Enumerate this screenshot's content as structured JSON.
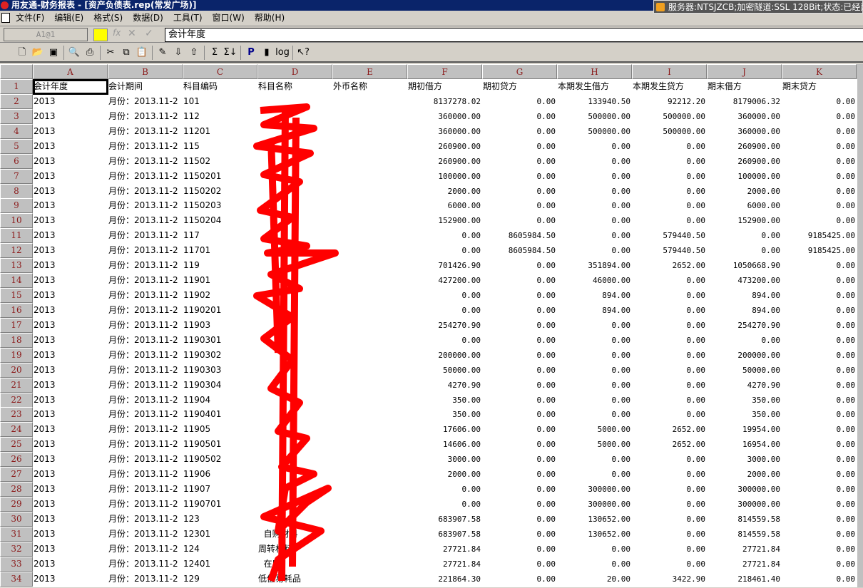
{
  "window": {
    "title": "用友通-财务报表 - [资产负债表.rep(常发广场)]",
    "server_status": "服务器:NTSJZCB;加密隧道:SSL 128Bit;状态:已经建"
  },
  "menu": [
    "文件(F)",
    "编辑(E)",
    "格式(S)",
    "数据(D)",
    "工具(T)",
    "窗口(W)",
    "帮助(H)"
  ],
  "formula": {
    "cell_ref": "A1@1",
    "fx": "fx",
    "cancel": "✕",
    "confirm": "✓",
    "value": "会计年度"
  },
  "toolbar": [
    "new-icon",
    "open-icon",
    "save-icon",
    "print-preview-icon",
    "print-icon",
    "cut-icon",
    "copy-icon",
    "paste-icon",
    "format-brush-icon",
    "sort-desc-icon",
    "sort-asc-icon",
    "sum-icon",
    "sum-column-icon",
    "p-icon",
    "marker-icon",
    "log-icon",
    "help-pointer-icon"
  ],
  "columns": [
    "A",
    "B",
    "C",
    "D",
    "E",
    "F",
    "G",
    "H",
    "I",
    "J",
    "K"
  ],
  "header_row": [
    "会计年度",
    "会计期间",
    "科目编码",
    "科目名称",
    "外币名称",
    "期初借方",
    "期初贷方",
    "本期发生借方",
    "本期发生贷方",
    "期末借方",
    "期末贷方"
  ],
  "year": "2013",
  "period": "月份：2013.11-2",
  "rows": [
    [
      "101",
      "",
      "8137278.02",
      "0.00",
      "133940.50",
      "92212.20",
      "8179006.32",
      "0.00"
    ],
    [
      "112",
      "",
      "360000.00",
      "0.00",
      "500000.00",
      "500000.00",
      "360000.00",
      "0.00"
    ],
    [
      "11201",
      "",
      "360000.00",
      "0.00",
      "500000.00",
      "500000.00",
      "360000.00",
      "0.00"
    ],
    [
      "115",
      "",
      "260900.00",
      "0.00",
      "0.00",
      "0.00",
      "260900.00",
      "0.00"
    ],
    [
      "11502",
      "",
      "260900.00",
      "0.00",
      "0.00",
      "0.00",
      "260900.00",
      "0.00"
    ],
    [
      "1150201",
      "",
      "100000.00",
      "0.00",
      "0.00",
      "0.00",
      "100000.00",
      "0.00"
    ],
    [
      "1150202",
      "",
      "2000.00",
      "0.00",
      "0.00",
      "0.00",
      "2000.00",
      "0.00"
    ],
    [
      "1150203",
      "",
      "6000.00",
      "0.00",
      "0.00",
      "0.00",
      "6000.00",
      "0.00"
    ],
    [
      "1150204",
      "",
      "152900.00",
      "0.00",
      "0.00",
      "0.00",
      "152900.00",
      "0.00"
    ],
    [
      "117",
      "",
      "0.00",
      "8605984.50",
      "0.00",
      "579440.50",
      "0.00",
      "9185425.00"
    ],
    [
      "11701",
      "",
      "0.00",
      "8605984.50",
      "0.00",
      "579440.50",
      "0.00",
      "9185425.00"
    ],
    [
      "119",
      "",
      "701426.90",
      "0.00",
      "351894.00",
      "2652.00",
      "1050668.90",
      "0.00"
    ],
    [
      "11901",
      "",
      "427200.00",
      "0.00",
      "46000.00",
      "0.00",
      "473200.00",
      "0.00"
    ],
    [
      "11902",
      "",
      "0.00",
      "0.00",
      "894.00",
      "0.00",
      "894.00",
      "0.00"
    ],
    [
      "1190201",
      "",
      "0.00",
      "0.00",
      "894.00",
      "0.00",
      "894.00",
      "0.00"
    ],
    [
      "11903",
      "",
      "254270.90",
      "0.00",
      "0.00",
      "0.00",
      "254270.90",
      "0.00"
    ],
    [
      "1190301",
      "",
      "0.00",
      "0.00",
      "0.00",
      "0.00",
      "0.00",
      "0.00"
    ],
    [
      "1190302",
      "",
      "200000.00",
      "0.00",
      "0.00",
      "0.00",
      "200000.00",
      "0.00"
    ],
    [
      "1190303",
      "",
      "50000.00",
      "0.00",
      "0.00",
      "0.00",
      "50000.00",
      "0.00"
    ],
    [
      "1190304",
      "",
      "4270.90",
      "0.00",
      "0.00",
      "0.00",
      "4270.90",
      "0.00"
    ],
    [
      "11904",
      "",
      "350.00",
      "0.00",
      "0.00",
      "0.00",
      "350.00",
      "0.00"
    ],
    [
      "1190401",
      "",
      "350.00",
      "0.00",
      "0.00",
      "0.00",
      "350.00",
      "0.00"
    ],
    [
      "11905",
      "",
      "17606.00",
      "0.00",
      "5000.00",
      "2652.00",
      "19954.00",
      "0.00"
    ],
    [
      "1190501",
      "",
      "14606.00",
      "0.00",
      "5000.00",
      "2652.00",
      "16954.00",
      "0.00"
    ],
    [
      "1190502",
      "",
      "3000.00",
      "0.00",
      "0.00",
      "0.00",
      "3000.00",
      "0.00"
    ],
    [
      "11906",
      "",
      "2000.00",
      "0.00",
      "0.00",
      "0.00",
      "2000.00",
      "0.00"
    ],
    [
      "11907",
      "",
      "0.00",
      "0.00",
      "300000.00",
      "0.00",
      "300000.00",
      "0.00"
    ],
    [
      "1190701",
      "",
      "0.00",
      "0.00",
      "300000.00",
      "0.00",
      "300000.00",
      "0.00"
    ],
    [
      "123",
      "",
      "683907.58",
      "0.00",
      "130652.00",
      "0.00",
      "814559.58",
      "0.00"
    ],
    [
      "12301",
      "  自购材料",
      "683907.58",
      "0.00",
      "130652.00",
      "0.00",
      "814559.58",
      "0.00"
    ],
    [
      "124",
      "周转材料",
      "27721.84",
      "0.00",
      "0.00",
      "0.00",
      "27721.84",
      "0.00"
    ],
    [
      "12401",
      "  在库",
      "27721.84",
      "0.00",
      "0.00",
      "0.00",
      "27721.84",
      "0.00"
    ],
    [
      "129",
      "低值易耗品",
      "221864.30",
      "0.00",
      "20.00",
      "3422.90",
      "218461.40",
      "0.00"
    ]
  ],
  "colors": {
    "titlebar": "#0a246a",
    "header_text": "#8b1a1a",
    "redaction": "#ff0000"
  }
}
